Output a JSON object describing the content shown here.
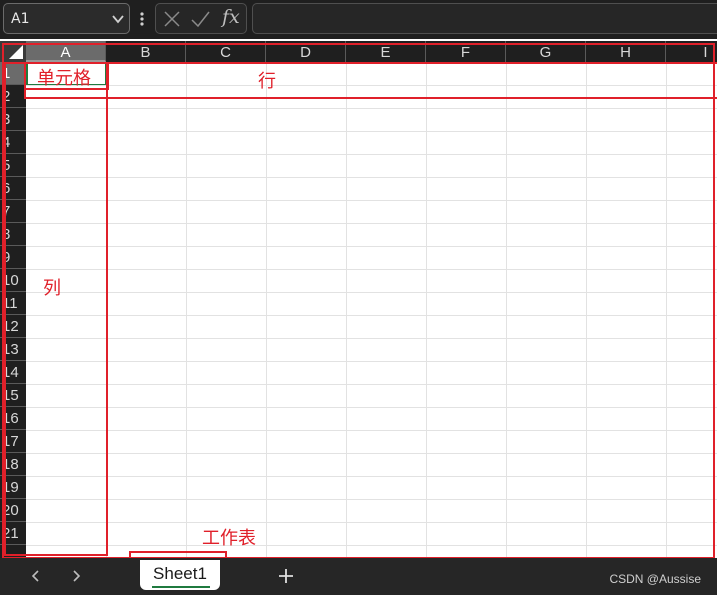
{
  "formula_bar": {
    "name_box": "A1",
    "fx_label": "fx",
    "formula_value": ""
  },
  "columns": [
    "A",
    "B",
    "C",
    "D",
    "E",
    "F",
    "G",
    "H",
    "I"
  ],
  "rows": [
    "1",
    "2",
    "3",
    "4",
    "5",
    "6",
    "7",
    "8",
    "9",
    "10",
    "11",
    "12",
    "13",
    "14",
    "15",
    "16",
    "17",
    "18",
    "19",
    "20",
    "21"
  ],
  "selection": {
    "active_cell": "A1",
    "active_column": "A",
    "active_row": "1"
  },
  "annotations": {
    "cell": "单元格",
    "row": "行",
    "column": "列",
    "worksheet": "工作表"
  },
  "sheets": [
    {
      "name": "Sheet1",
      "active": true
    }
  ],
  "watermark": "CSDN @Aussise",
  "colors": {
    "annotation_red": "#e0202a",
    "active_green": "#1f7a3f",
    "chrome_dark": "#1f1f1f"
  },
  "icons": {
    "name_box_dropdown": "chevron-down-icon",
    "more": "vertical-dots-icon",
    "cancel": "close-icon",
    "enter": "check-icon",
    "prev_sheet": "chevron-left-icon",
    "next_sheet": "chevron-right-icon",
    "add_sheet": "plus-icon"
  }
}
